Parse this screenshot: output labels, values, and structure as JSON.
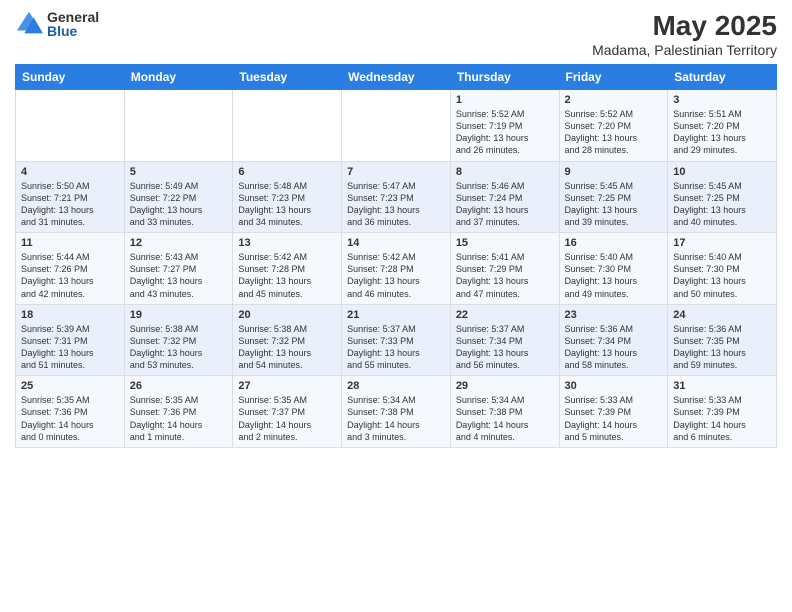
{
  "logo": {
    "general": "General",
    "blue": "Blue"
  },
  "header": {
    "title": "May 2025",
    "subtitle": "Madama, Palestinian Territory"
  },
  "weekdays": [
    "Sunday",
    "Monday",
    "Tuesday",
    "Wednesday",
    "Thursday",
    "Friday",
    "Saturday"
  ],
  "weeks": [
    [
      {
        "day": "",
        "content": ""
      },
      {
        "day": "",
        "content": ""
      },
      {
        "day": "",
        "content": ""
      },
      {
        "day": "",
        "content": ""
      },
      {
        "day": "1",
        "content": "Sunrise: 5:52 AM\nSunset: 7:19 PM\nDaylight: 13 hours\nand 26 minutes."
      },
      {
        "day": "2",
        "content": "Sunrise: 5:52 AM\nSunset: 7:20 PM\nDaylight: 13 hours\nand 28 minutes."
      },
      {
        "day": "3",
        "content": "Sunrise: 5:51 AM\nSunset: 7:20 PM\nDaylight: 13 hours\nand 29 minutes."
      }
    ],
    [
      {
        "day": "4",
        "content": "Sunrise: 5:50 AM\nSunset: 7:21 PM\nDaylight: 13 hours\nand 31 minutes."
      },
      {
        "day": "5",
        "content": "Sunrise: 5:49 AM\nSunset: 7:22 PM\nDaylight: 13 hours\nand 33 minutes."
      },
      {
        "day": "6",
        "content": "Sunrise: 5:48 AM\nSunset: 7:23 PM\nDaylight: 13 hours\nand 34 minutes."
      },
      {
        "day": "7",
        "content": "Sunrise: 5:47 AM\nSunset: 7:23 PM\nDaylight: 13 hours\nand 36 minutes."
      },
      {
        "day": "8",
        "content": "Sunrise: 5:46 AM\nSunset: 7:24 PM\nDaylight: 13 hours\nand 37 minutes."
      },
      {
        "day": "9",
        "content": "Sunrise: 5:45 AM\nSunset: 7:25 PM\nDaylight: 13 hours\nand 39 minutes."
      },
      {
        "day": "10",
        "content": "Sunrise: 5:45 AM\nSunset: 7:25 PM\nDaylight: 13 hours\nand 40 minutes."
      }
    ],
    [
      {
        "day": "11",
        "content": "Sunrise: 5:44 AM\nSunset: 7:26 PM\nDaylight: 13 hours\nand 42 minutes."
      },
      {
        "day": "12",
        "content": "Sunrise: 5:43 AM\nSunset: 7:27 PM\nDaylight: 13 hours\nand 43 minutes."
      },
      {
        "day": "13",
        "content": "Sunrise: 5:42 AM\nSunset: 7:28 PM\nDaylight: 13 hours\nand 45 minutes."
      },
      {
        "day": "14",
        "content": "Sunrise: 5:42 AM\nSunset: 7:28 PM\nDaylight: 13 hours\nand 46 minutes."
      },
      {
        "day": "15",
        "content": "Sunrise: 5:41 AM\nSunset: 7:29 PM\nDaylight: 13 hours\nand 47 minutes."
      },
      {
        "day": "16",
        "content": "Sunrise: 5:40 AM\nSunset: 7:30 PM\nDaylight: 13 hours\nand 49 minutes."
      },
      {
        "day": "17",
        "content": "Sunrise: 5:40 AM\nSunset: 7:30 PM\nDaylight: 13 hours\nand 50 minutes."
      }
    ],
    [
      {
        "day": "18",
        "content": "Sunrise: 5:39 AM\nSunset: 7:31 PM\nDaylight: 13 hours\nand 51 minutes."
      },
      {
        "day": "19",
        "content": "Sunrise: 5:38 AM\nSunset: 7:32 PM\nDaylight: 13 hours\nand 53 minutes."
      },
      {
        "day": "20",
        "content": "Sunrise: 5:38 AM\nSunset: 7:32 PM\nDaylight: 13 hours\nand 54 minutes."
      },
      {
        "day": "21",
        "content": "Sunrise: 5:37 AM\nSunset: 7:33 PM\nDaylight: 13 hours\nand 55 minutes."
      },
      {
        "day": "22",
        "content": "Sunrise: 5:37 AM\nSunset: 7:34 PM\nDaylight: 13 hours\nand 56 minutes."
      },
      {
        "day": "23",
        "content": "Sunrise: 5:36 AM\nSunset: 7:34 PM\nDaylight: 13 hours\nand 58 minutes."
      },
      {
        "day": "24",
        "content": "Sunrise: 5:36 AM\nSunset: 7:35 PM\nDaylight: 13 hours\nand 59 minutes."
      }
    ],
    [
      {
        "day": "25",
        "content": "Sunrise: 5:35 AM\nSunset: 7:36 PM\nDaylight: 14 hours\nand 0 minutes."
      },
      {
        "day": "26",
        "content": "Sunrise: 5:35 AM\nSunset: 7:36 PM\nDaylight: 14 hours\nand 1 minute."
      },
      {
        "day": "27",
        "content": "Sunrise: 5:35 AM\nSunset: 7:37 PM\nDaylight: 14 hours\nand 2 minutes."
      },
      {
        "day": "28",
        "content": "Sunrise: 5:34 AM\nSunset: 7:38 PM\nDaylight: 14 hours\nand 3 minutes."
      },
      {
        "day": "29",
        "content": "Sunrise: 5:34 AM\nSunset: 7:38 PM\nDaylight: 14 hours\nand 4 minutes."
      },
      {
        "day": "30",
        "content": "Sunrise: 5:33 AM\nSunset: 7:39 PM\nDaylight: 14 hours\nand 5 minutes."
      },
      {
        "day": "31",
        "content": "Sunrise: 5:33 AM\nSunset: 7:39 PM\nDaylight: 14 hours\nand 6 minutes."
      }
    ]
  ]
}
